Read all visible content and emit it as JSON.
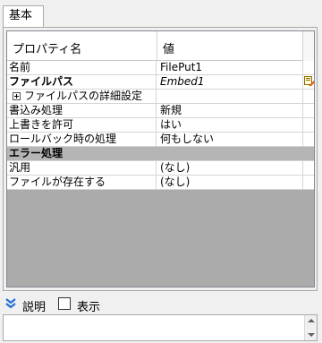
{
  "tabs": [
    {
      "label": "基本"
    }
  ],
  "grid": {
    "header": {
      "col_property": "プロパティ名",
      "col_value": "値"
    },
    "rows": [
      {
        "name": "名前",
        "value": "FilePut1"
      },
      {
        "name": "ファイルパス",
        "value": "Embed1"
      },
      {
        "name": "ファイルパスの詳細設定",
        "value": ""
      },
      {
        "name": "書込み処理",
        "value": "新規"
      },
      {
        "name": "上書きを許可",
        "value": "はい"
      },
      {
        "name": "ロールバック時の処理",
        "value": "何もしない"
      },
      {
        "name": "エラー処理",
        "value": ""
      },
      {
        "name": "汎用",
        "value": "(なし)"
      },
      {
        "name": "ファイルが存在する",
        "value": "(なし)"
      }
    ]
  },
  "description": {
    "label": "説明",
    "show_label": "表示",
    "show_checked": false
  },
  "icons": {
    "collapse": "double-chevron-down-icon",
    "edit": "edit-path-icon",
    "expand": "plus-box-icon"
  },
  "colors": {
    "accent": "#1e6fd9",
    "category_bg": "#b5b5b5",
    "grid_bg": "#ababab"
  }
}
